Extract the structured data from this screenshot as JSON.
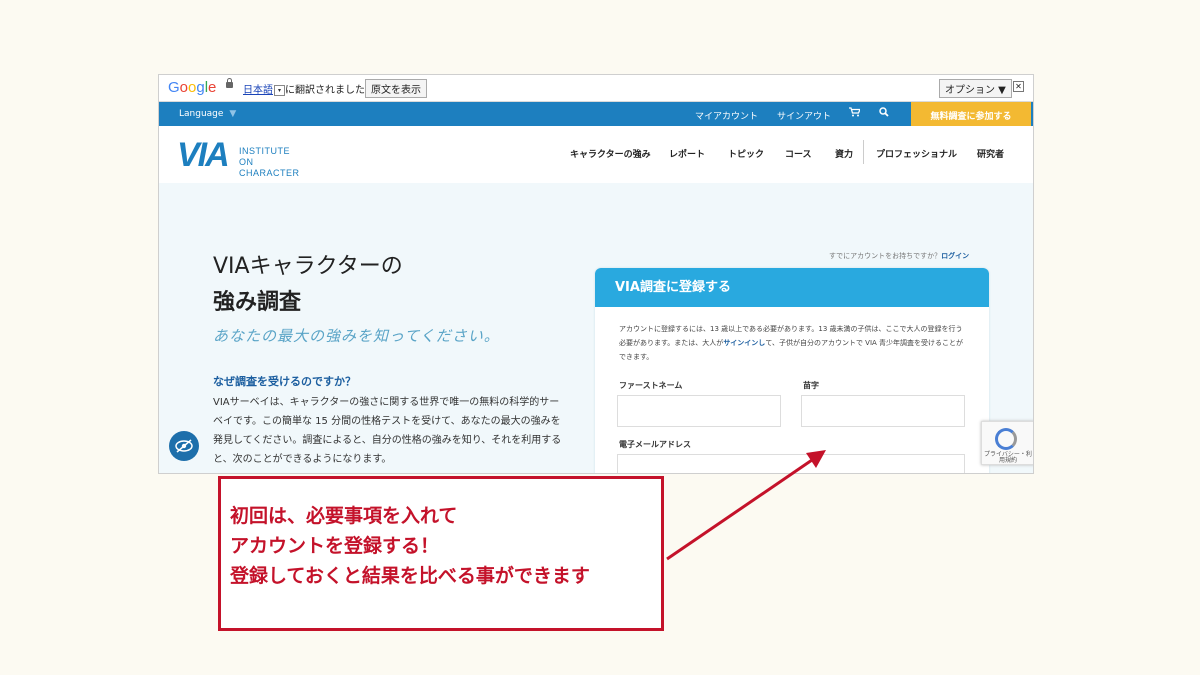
{
  "translate_bar": {
    "logo": "Google",
    "language": "日本語",
    "dropdown_glyph": "▾",
    "status": "に翻訳されました",
    "show_original": "原文を表示",
    "options": "オプション ▼",
    "close": "✕"
  },
  "topnav": {
    "language": "Language",
    "language_caret": "▼",
    "my_account": "マイアカウント",
    "sign_out": "サインアウト",
    "cart_icon": "cart-icon",
    "search_icon": "search-icon",
    "cta": "無料調査に参加する"
  },
  "header": {
    "logo_mark": "VIA",
    "logo_line1": "INSTITUTE ON",
    "logo_line2": "CHARACTER",
    "menu": [
      "キャラクターの強み",
      "レポート",
      "トピック",
      "コース",
      "資力",
      "プロフェッショナル",
      "研究者"
    ]
  },
  "hero": {
    "title_line1": "VIAキャラクターの",
    "title_line2": "強み調査",
    "tagline": "あなたの最大の強みを知ってください。",
    "why_heading": "なぜ調査を受けるのですか？",
    "paragraph": "VIAサーベイは、キャラクターの強さに関する世界で唯一の無料の科学的サーベイです。この簡単な 15 分間の性格テストを受けて、あなたの最大の強みを発見してください。調査によると、自分の性格の強みを知り、それを利用すると、次のことができるようになります。",
    "already_account": "すでにアカウントをお持ちですか？",
    "login": "ログイン"
  },
  "signup_card": {
    "title": "VIA調査に登録する",
    "note_part1": "アカウントに登録するには、13 歳以上である必要があります。13 歳未満の子供は、ここで大人の登録を行う必要があります。または、大人が",
    "note_link": "サインインし",
    "note_part2": "て、子供が自分のアカウントで VIA 青少年調査を受けることができます。",
    "first_name_label": "ファーストネーム",
    "last_name_label": "苗字",
    "email_label": "電子メールアドレス"
  },
  "recaptcha": {
    "text": "プライバシー・利用規約"
  },
  "annotation": {
    "line1": "初回は、必要事項を入れて",
    "line2": "アカウントを登録する！",
    "line3": "登録しておくと結果を比べる事ができます",
    "color": "#c4122a"
  }
}
